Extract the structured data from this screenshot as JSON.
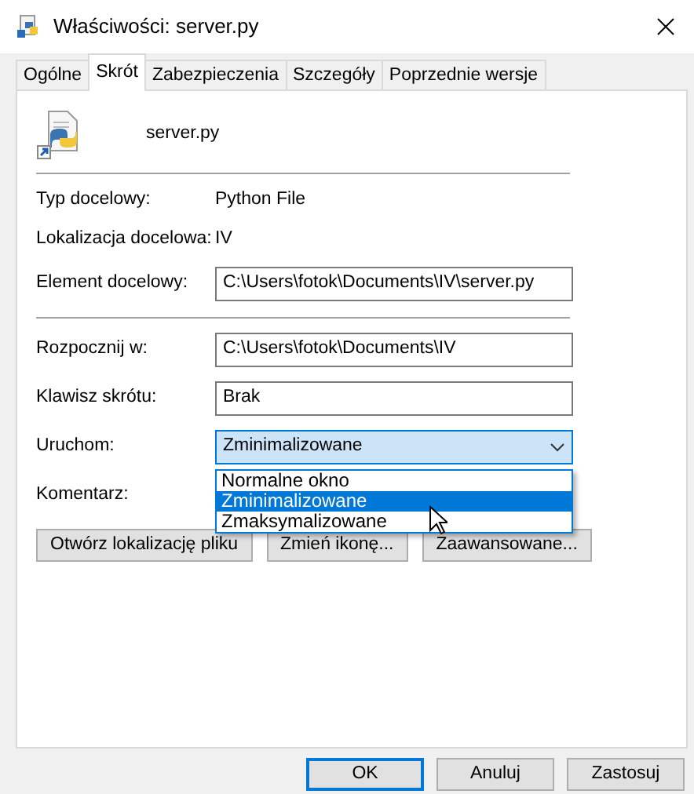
{
  "window": {
    "title": "Właściwości: server.py"
  },
  "tabs": [
    {
      "label": "Ogólne",
      "selected": false
    },
    {
      "label": "Skrót",
      "selected": true
    },
    {
      "label": "Zabezpieczenia",
      "selected": false
    },
    {
      "label": "Szczegóły",
      "selected": false
    },
    {
      "label": "Poprzednie wersje",
      "selected": false
    }
  ],
  "file_name": "server.py",
  "groups": [
    [
      {
        "kind": "text",
        "label": "Typ docelowy:",
        "value": "Python File"
      },
      {
        "kind": "text",
        "label": "Lokalizacja docelowa:",
        "value": "IV"
      },
      {
        "kind": "field",
        "label": "Element docelowy:",
        "value": "C:\\Users\\fotok\\Documents\\IV\\server.py"
      }
    ],
    [
      {
        "kind": "field",
        "label": "Rozpocznij w:",
        "value": "C:\\Users\\fotok\\Documents\\IV"
      },
      {
        "kind": "field",
        "label": "Klawisz skrótu:",
        "value": "Brak"
      },
      {
        "kind": "select",
        "label": "Uruchom:",
        "value": "Zminimalizowane",
        "expanded": true,
        "options": [
          {
            "label": "Normalne okno",
            "selected": false
          },
          {
            "label": "Zminimalizowane",
            "selected": true
          },
          {
            "label": "Zmaksymalizowane",
            "selected": false
          }
        ]
      },
      {
        "kind": "label",
        "label": "Komentarz:"
      }
    ]
  ],
  "actions": [
    "Otwórz lokalizację pliku",
    "Zmień ikonę...",
    "Zaawansowane..."
  ],
  "footer_buttons": [
    {
      "label": "OK",
      "default": true
    },
    {
      "label": "Anuluj",
      "default": false
    },
    {
      "label": "Zastosuj",
      "default": false
    }
  ]
}
